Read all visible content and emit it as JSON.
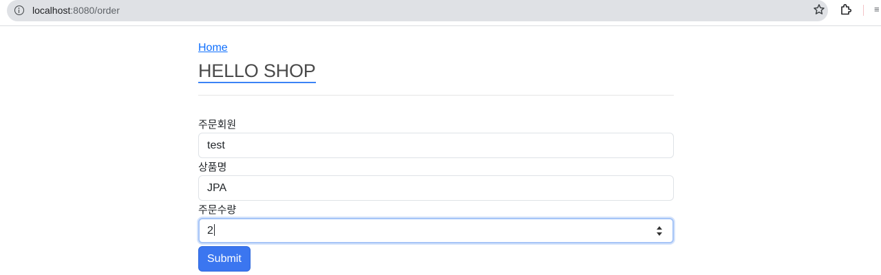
{
  "browser": {
    "url_host": "localhost",
    "url_path": ":8080/order",
    "menu_glyph": "≡"
  },
  "page": {
    "home_link": "Home",
    "title": "HELLO SHOP"
  },
  "form": {
    "member": {
      "label": "주문회원",
      "value": "test"
    },
    "item": {
      "label": "상품명",
      "value": "JPA"
    },
    "count": {
      "label": "주문수량",
      "value": "2"
    },
    "submit_label": "Submit"
  },
  "colors": {
    "accent": "#3b76f0",
    "link": "#0d6efd",
    "focus_ring": "#a5c4f7"
  }
}
